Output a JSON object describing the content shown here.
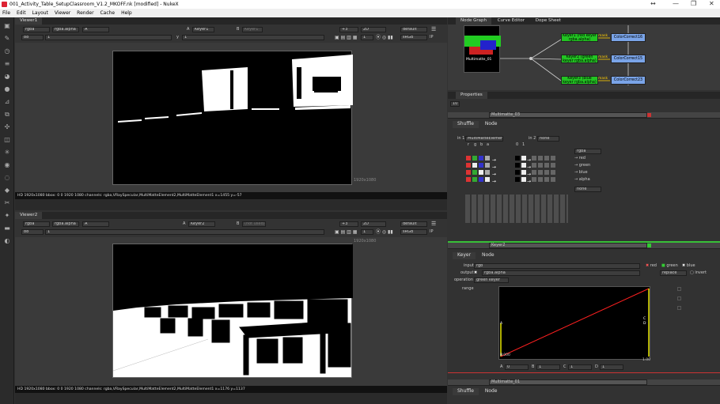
{
  "app": {
    "title": "001_Activity_Table_SetupClassroom_V1.2_MKOFF.nk [modified] - NukeX"
  },
  "menu": [
    "File",
    "Edit",
    "Layout",
    "Viewer",
    "Render",
    "Cache",
    "Help"
  ],
  "viewer1": {
    "tab": "Viewer1",
    "channels": "rgba",
    "alpha": "rgba.alpha",
    "aChan": "A",
    "aLabel": "A",
    "aNode": "Keyer1",
    "bLabel": "B",
    "bNode": "Keyer1",
    "gain": "+3",
    "mode": "2D",
    "lut": "default",
    "cs": "sRGB",
    "frameField": "1",
    "frameLeft": "88",
    "yLabel": "y",
    "yVal": "1",
    "res": "1920x1080",
    "info": "HD 1920x1080  bbox: 0 0 1920 1080  channels: rgba,VRaySpecular,MultiMatteElement2,MultiMatteElement1     x=1455 y=-57"
  },
  "viewer2": {
    "tab": "Viewer2",
    "channels": "rgba",
    "alpha": "rgba.alpha",
    "aChan": "A",
    "aLabel": "A",
    "aNode": "Keyer2",
    "bLabel": "B",
    "bNode": "(not used)",
    "gain": "+3",
    "mode": "2D",
    "lut": "default",
    "cs": "sRGB",
    "frameField": "1",
    "frameLeft": "88",
    "res": "1920x1080",
    "info": "HD 1920x1080  bbox: 0 0 1920 1080  channels: rgba,VRaySpecular,MultiMatteElement2,MultiMatteElement1     x=1176 y=1137"
  },
  "graph": {
    "tabs": [
      "Node Graph",
      "Curve Editor",
      "Dope Sheet"
    ],
    "keyer1": "Keyer1 (red keyer rgba.alpha)",
    "keyer2": "Keyer2 (green keyer rgba.alpha)",
    "keyer3": "Keyer3 (blue keyer rgba.alpha)",
    "cc1": "ColorCorrect16",
    "cc2": "ColorCorrect15",
    "cc3": "ColorCorrect23",
    "mask": "mask",
    "multimatte": "Multimatte_01"
  },
  "props": {
    "tab": "Properties",
    "count": "10",
    "shuffle": {
      "name": "Multimatte_03",
      "tabs": [
        "Shuffle",
        "Node"
      ],
      "in1Label": "in 1",
      "in1": "MultiMatteElement3",
      "in2Label": "in 2",
      "in2": "none",
      "cols1": [
        "r",
        "g",
        "b",
        "a"
      ],
      "cols2": [
        "0",
        "1"
      ],
      "outTop": "rgba",
      "outBottom": "none",
      "outs": [
        "red",
        "green",
        "blue",
        "alpha"
      ]
    },
    "keyer": {
      "name": "Keyer2",
      "tabs": [
        "Keyer",
        "Node"
      ],
      "inputLabel": "input",
      "input": "rgb",
      "outputLabel": "output",
      "output": "rgba.alpha",
      "operationLabel": "operation",
      "operation": "green keyer",
      "rangeLabel": "range",
      "chkRed": "red",
      "chkGreen": "green",
      "chkBlue": "blue",
      "replace": "replace",
      "invert": "invert",
      "curveA": "A",
      "curveB": "B",
      "curveC": "C",
      "curveD": "D",
      "axisMin": "0.000",
      "axisMax": "1.00",
      "fA": "0",
      "fB": "1",
      "fC": "1",
      "fD": "1",
      "lblA": "A",
      "lblB": "B",
      "lblC": "C",
      "lblD": "D"
    },
    "shuffle2": {
      "name": "Multimatte_01",
      "tabs": [
        "Shuffle",
        "Node"
      ]
    }
  },
  "colors": {
    "accentGreen": "#38c038",
    "keyerNode": "#22c422",
    "ccNode": "#7aa4e8",
    "curveRed": "#ff2020",
    "curveYellow": "#e8e800"
  }
}
